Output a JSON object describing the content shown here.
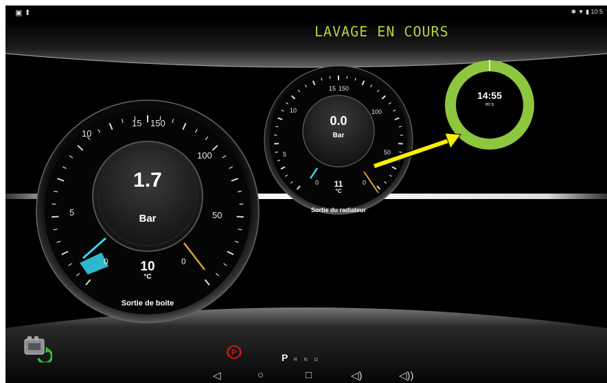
{
  "status_bar": {
    "left_icons": "▣ ⬆",
    "right_text": "✱ ▼ ▮ 10:5"
  },
  "banner": {
    "title": "LAVAGE EN COURS"
  },
  "gauge_left": {
    "value": "1.7",
    "unit": "Bar",
    "temp": "10",
    "temp_unit": "°C",
    "label": "Sortie de boite",
    "ticks_left": [
      "5",
      "10",
      "15"
    ],
    "ticks_right": [
      "150",
      "100",
      "50"
    ],
    "zero_left": "0",
    "zero_right": "0"
  },
  "gauge_right": {
    "value": "0.0",
    "unit": "Bar",
    "temp": "11",
    "temp_unit": "°C",
    "label": "Sortie du radiateur",
    "ticks_left": [
      "5",
      "10",
      "15"
    ],
    "ticks_right": [
      "150",
      "100",
      "50"
    ],
    "zero_left": "0",
    "zero_right": "0"
  },
  "timer": {
    "time": "14:55",
    "unit": "m:s",
    "ring_color": "#8dc63f"
  },
  "annotation": {
    "arrow_color": "#f7f000"
  },
  "gear_selector": {
    "parking_icon": "parking-brake-icon",
    "active": "P",
    "others": "R N D"
  },
  "nav": {
    "back": "◁",
    "home": "○",
    "recents": "□",
    "vol_down": "◁)",
    "vol_up": "◁))"
  },
  "colors": {
    "cold": "#3ad7f0",
    "hot": "#e0a030",
    "accent": "#b5d23a"
  }
}
